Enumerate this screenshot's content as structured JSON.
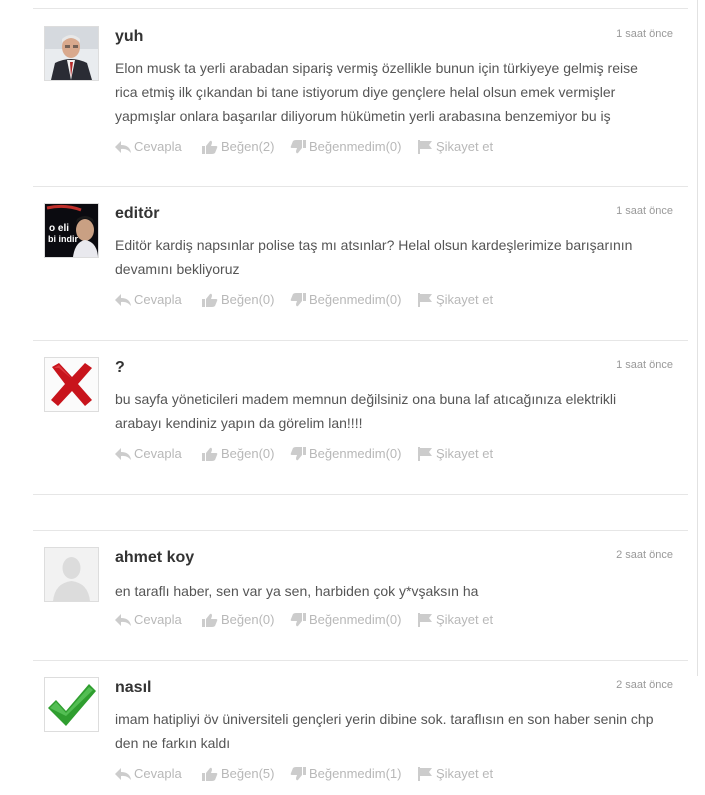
{
  "comments": [
    {
      "author": "yuh",
      "time": "1 saat önce",
      "avatar": "man-in-suit-photo",
      "text_lines": [
        "Elon musk ta yerli arabadan sipariş vermiş özellikle bunun için türkiyeye gelmiş reise",
        "rica etmiş ilk çıkandan bi tane istiyorum diye gençlere helal olsun emek vermişler",
        "yapmışlar onlara başarılar diliyorum hükümetin yerli arabasına benzemiyor bu iş"
      ],
      "actions": {
        "reply": "Cevapla",
        "like": "Beğen(2)",
        "dislike": "Beğenmedim(0)",
        "report": "Şikayet et"
      }
    },
    {
      "author": "editör",
      "time": "1 saat önce",
      "avatar": "football-player-photo",
      "avatar_text": [
        "o eli",
        "bi indir"
      ],
      "text_lines": [
        "Editör kardiş napsınlar polise taş mı atsınlar? Helal olsun kardeşlerimize barışarının",
        "devamını bekliyoruz"
      ],
      "actions": {
        "reply": "Cevapla",
        "like": "Beğen(0)",
        "dislike": "Beğenmedim(0)",
        "report": "Şikayet et"
      }
    },
    {
      "author": "?",
      "time": "1 saat önce",
      "avatar": "red-cross-icon",
      "text_lines": [
        "bu sayfa yöneticileri madem memnun değilsiniz ona buna laf atıcağınıza elektrikli",
        "arabayı kendiniz yapın da görelim lan!!!!"
      ],
      "actions": {
        "reply": "Cevapla",
        "like": "Beğen(0)",
        "dislike": "Beğenmedim(0)",
        "report": "Şikayet et"
      }
    },
    {
      "author": "ahmet koy",
      "time": "2 saat önce",
      "avatar": "default-user-icon",
      "text_lines": [
        "en taraflı haber, sen var ya sen, harbiden çok y*vşaksın ha"
      ],
      "actions": {
        "reply": "Cevapla",
        "like": "Beğen(0)",
        "dislike": "Beğenmedim(0)",
        "report": "Şikayet et"
      }
    },
    {
      "author": "nasıl",
      "time": "2 saat önce",
      "avatar": "green-check-icon",
      "text_lines": [
        "imam hatipliyi öv üniversiteli gençleri yerin dibine sok. taraflısın en son haber senin chp",
        "den ne farkın kaldı"
      ],
      "actions": {
        "reply": "Cevapla",
        "like": "Beğen(5)",
        "dislike": "Beğenmedim(1)",
        "report": "Şikayet et"
      }
    }
  ],
  "colors": {
    "action": "#b8b8b8",
    "author": "#333333",
    "text": "#555555",
    "time": "#999999",
    "divider": "#e6e6e6"
  }
}
